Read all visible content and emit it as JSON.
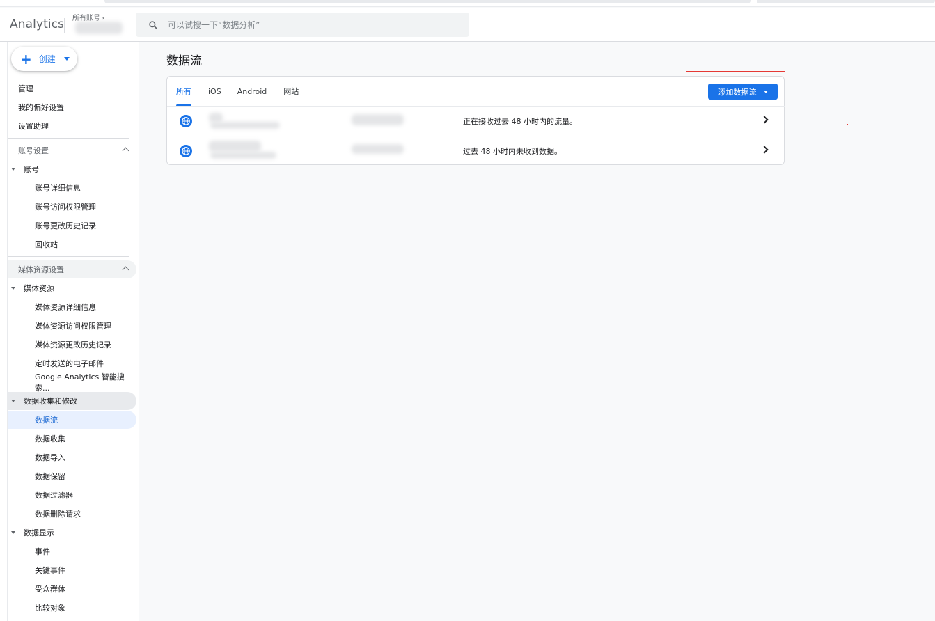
{
  "app": {
    "brand": "Analytics",
    "account_label": "所有账号",
    "search_placeholder": "可以试搜一下“数据分析”"
  },
  "sidebar": {
    "create_label": "创建",
    "top_items": [
      "管理",
      "我的偏好设置",
      "设置助理"
    ],
    "account_section": {
      "title": "账号设置",
      "group": "账号",
      "items": [
        "账号详细信息",
        "账号访问权限管理",
        "账号更改历史记录",
        "回收站"
      ]
    },
    "property_section": {
      "title": "媒体资源设置",
      "property_group": "媒体资源",
      "property_items": [
        "媒体资源详细信息",
        "媒体资源访问权限管理",
        "媒体资源更改历史记录",
        "定时发送的电子邮件",
        "Google Analytics 智能搜索..."
      ],
      "data_collection_group": "数据收集和修改",
      "data_collection_items": [
        "数据流",
        "数据收集",
        "数据导入",
        "数据保留",
        "数据过滤器",
        "数据删除请求"
      ],
      "display_group": "数据显示",
      "display_items": [
        "事件",
        "关键事件",
        "受众群体",
        "比较对象"
      ]
    },
    "active_item": "数据流"
  },
  "main": {
    "title": "数据流",
    "tabs": [
      "所有",
      "iOS",
      "Android",
      "网站"
    ],
    "active_tab": "所有",
    "add_button": "添加数据流",
    "streams": [
      {
        "status": "正在接收过去 48 小时内的流量。"
      },
      {
        "status": "过去 48 小时内未收到数据。"
      }
    ]
  },
  "colors": {
    "accent": "#1a73e8",
    "highlight": "#e53935"
  }
}
